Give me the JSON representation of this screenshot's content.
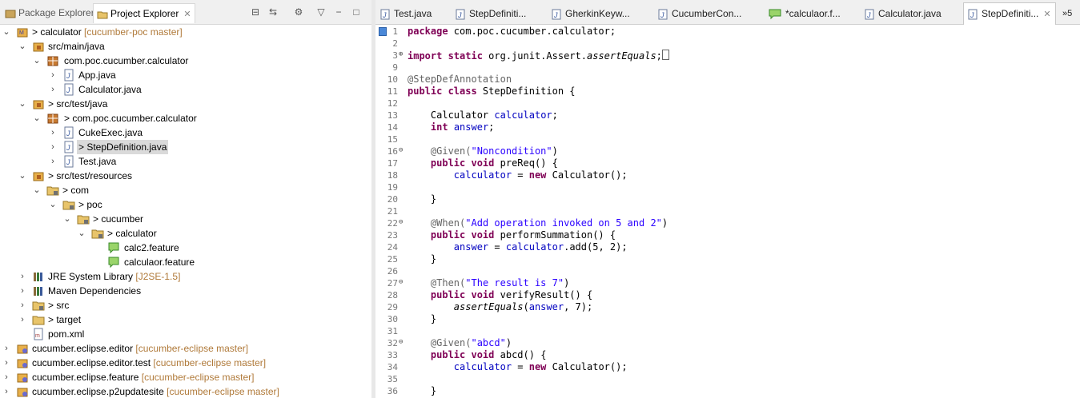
{
  "left_tabs": {
    "package_explorer": "Package Explorer",
    "project_explorer": "Project Explorer"
  },
  "tree": {
    "calculator": "> calculator",
    "calculator_deco": "[cucumber-poc master]",
    "src_main_java": "src/main/java",
    "pkg_main": "com.poc.cucumber.calculator",
    "app_java": "App.java",
    "calculator_java": "Calculator.java",
    "src_test_java": "> src/test/java",
    "pkg_test": "> com.poc.cucumber.calculator",
    "cukeexec": "CukeExec.java",
    "stepdef": "> StepDefinition.java",
    "test_java": "Test.java",
    "src_test_resources": "> src/test/resources",
    "com": "> com",
    "poc": "> poc",
    "cucumber": "> cucumber",
    "calc_folder": "> calculator",
    "calc2_feature": "calc2.feature",
    "calculaor_feature": "calculaor.feature",
    "jre": "JRE System Library",
    "jre_deco": "[J2SE-1.5]",
    "maven": "Maven Dependencies",
    "src": "> src",
    "target": "> target",
    "pom": "pom.xml",
    "ce_editor": "cucumber.eclipse.editor",
    "ce_editor_deco": "[cucumber-eclipse master]",
    "ce_editor_test": "cucumber.eclipse.editor.test",
    "ce_editor_test_deco": "[cucumber-eclipse master]",
    "ce_feature": "cucumber.eclipse.feature",
    "ce_feature_deco": "[cucumber-eclipse master]",
    "ce_p2": "cucumber.eclipse.p2updatesite",
    "ce_p2_deco": "[cucumber-eclipse master]"
  },
  "editor_tabs": {
    "t1": "Test.java",
    "t2": "StepDefiniti...",
    "t3": "GherkinKeyw...",
    "t4": "CucumberCon...",
    "t5": "*calculaor.f...",
    "t6": "Calculator.java",
    "t7": "StepDefiniti...",
    "overflow": "»5"
  },
  "code": {
    "l1": {
      "n": "1",
      "kw": "package",
      "rest": " com.poc.cucumber.calculator;"
    },
    "l2": {
      "n": "2"
    },
    "l3": {
      "n": "3",
      "kw": "import static",
      "rest": " org.junit.Assert.",
      "ital": "assertEquals",
      "tail": ";"
    },
    "l9": {
      "n": "9"
    },
    "l10": {
      "n": "10",
      "ann": "@StepDefAnnotation"
    },
    "l11": {
      "n": "11",
      "kw": "public class",
      "rest": " StepDefinition {"
    },
    "l12": {
      "n": "12"
    },
    "l13": {
      "n": "13",
      "type": "Calculator ",
      "field": "calculator",
      "tail": ";"
    },
    "l14": {
      "n": "14",
      "kw": "int",
      "field": " answer",
      "tail": ";"
    },
    "l15": {
      "n": "15"
    },
    "l16": {
      "n": "16",
      "ann": "@Given(",
      "str": "\"Noncondition\"",
      "tail": ")"
    },
    "l17": {
      "n": "17",
      "kw": "public void",
      "rest": " preReq() {"
    },
    "l18": {
      "n": "18",
      "field": "calculator",
      "rest": " = ",
      "kw": "new",
      "tail": " Calculator();"
    },
    "l19": {
      "n": "19"
    },
    "l20": {
      "n": "20",
      "text": "}"
    },
    "l21": {
      "n": "21"
    },
    "l22": {
      "n": "22",
      "ann": "@When(",
      "str": "\"Add operation invoked on 5 and 2\"",
      "tail": ")"
    },
    "l23": {
      "n": "23",
      "kw": "public void",
      "rest": " performSummation() {"
    },
    "l24": {
      "n": "24",
      "field": "answer",
      "rest": " = ",
      "field2": "calculator",
      "tail": ".add(5, 2);"
    },
    "l25": {
      "n": "25",
      "text": "}"
    },
    "l26": {
      "n": "26"
    },
    "l27": {
      "n": "27",
      "ann": "@Then(",
      "str": "\"The result is 7\"",
      "tail": ")"
    },
    "l28": {
      "n": "28",
      "kw": "public void",
      "rest": " verifyResult() {"
    },
    "l29": {
      "n": "29",
      "ital": "assertEquals",
      "rest": "(",
      "field": "answer",
      "tail": ", 7);"
    },
    "l30": {
      "n": "30",
      "text": "}"
    },
    "l31": {
      "n": "31"
    },
    "l32": {
      "n": "32",
      "ann": "@Given(",
      "str": "\"abcd\"",
      "tail": ")"
    },
    "l33": {
      "n": "33",
      "kw": "public void",
      "rest": " abcd() {"
    },
    "l34": {
      "n": "34",
      "field": "calculator",
      "rest": " = ",
      "kw": "new",
      "tail": " Calculator();"
    },
    "l35": {
      "n": "35"
    },
    "l36": {
      "n": "36",
      "text": "}"
    }
  }
}
